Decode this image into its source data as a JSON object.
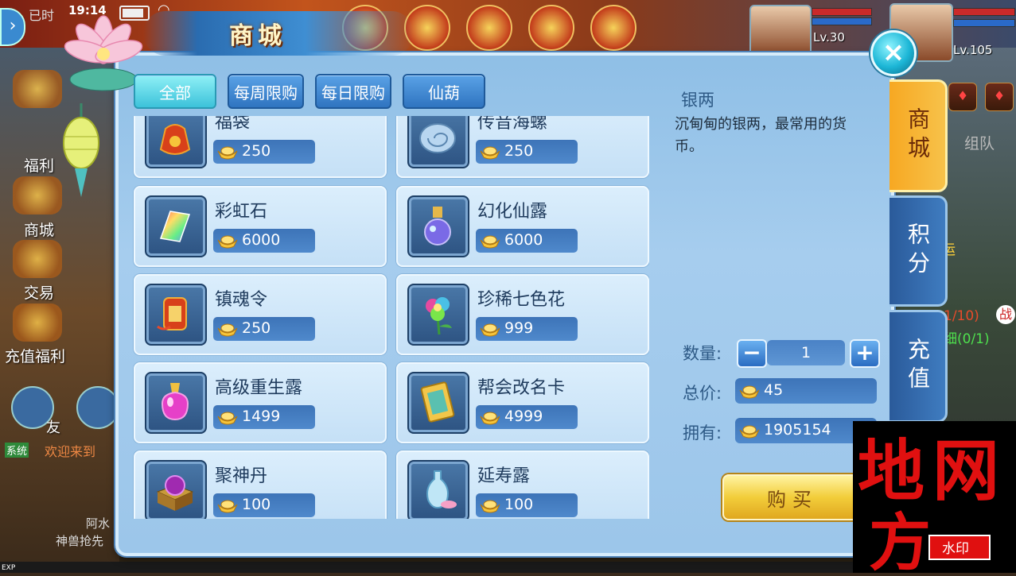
{
  "status": {
    "left_label": "已时",
    "time": "19:14"
  },
  "levels": {
    "pet_level": "Lv.30",
    "player_level": "Lv.105"
  },
  "left_menu": [
    "福利",
    "商城",
    "交易",
    "充值福利"
  ],
  "left_bottom": {
    "friend": "友",
    "system": "系统",
    "system_msg": "欢迎来到",
    "bottom_text_1": "阿水",
    "bottom_text_2": "神兽抢先",
    "exp": "EXP"
  },
  "right_bg": {
    "team": "组队",
    "yun": "运",
    "quest": "1/10)",
    "battle": "战",
    "detail": "细(0/1)"
  },
  "shop": {
    "title": "商城",
    "tabs": [
      "全部",
      "每周限购",
      "每日限购",
      "仙葫"
    ],
    "items": [
      {
        "name": "福袋",
        "price": "250",
        "icon": "lucky-bag-icon"
      },
      {
        "name": "传音海螺",
        "price": "250",
        "icon": "conch-icon"
      },
      {
        "name": "彩虹石",
        "price": "6000",
        "icon": "rainbow-stone-icon"
      },
      {
        "name": "幻化仙露",
        "price": "6000",
        "icon": "potion-bottle-icon"
      },
      {
        "name": "镇魂令",
        "price": "250",
        "icon": "soul-token-icon"
      },
      {
        "name": "珍稀七色花",
        "price": "999",
        "icon": "flower-icon"
      },
      {
        "name": "高级重生露",
        "price": "1499",
        "icon": "rebirth-potion-icon"
      },
      {
        "name": "帮会改名卡",
        "price": "4999",
        "icon": "rename-card-icon"
      },
      {
        "name": "聚神丹",
        "price": "100",
        "icon": "treasure-box-icon"
      },
      {
        "name": "延寿露",
        "price": "100",
        "icon": "vase-icon"
      }
    ],
    "detail": {
      "name": "银两",
      "description": "沉甸甸的银两，最常用的货币。"
    },
    "quantity_label": "数量:",
    "quantity": "1",
    "total_label": "总价:",
    "total": "45",
    "owned_label": "拥有:",
    "owned": "1905154",
    "buy_label": "购买",
    "close_symbol": "×"
  },
  "side_tabs": [
    "商城",
    "积分",
    "充值"
  ],
  "watermark": {
    "text_big": "地方网",
    "text_small": "水印"
  },
  "colors": {
    "tab_active": "#3cc2da",
    "buy_button": "#f2cd3a",
    "side_tab_active": "#f7a822",
    "watermark_red": "#e01010"
  }
}
